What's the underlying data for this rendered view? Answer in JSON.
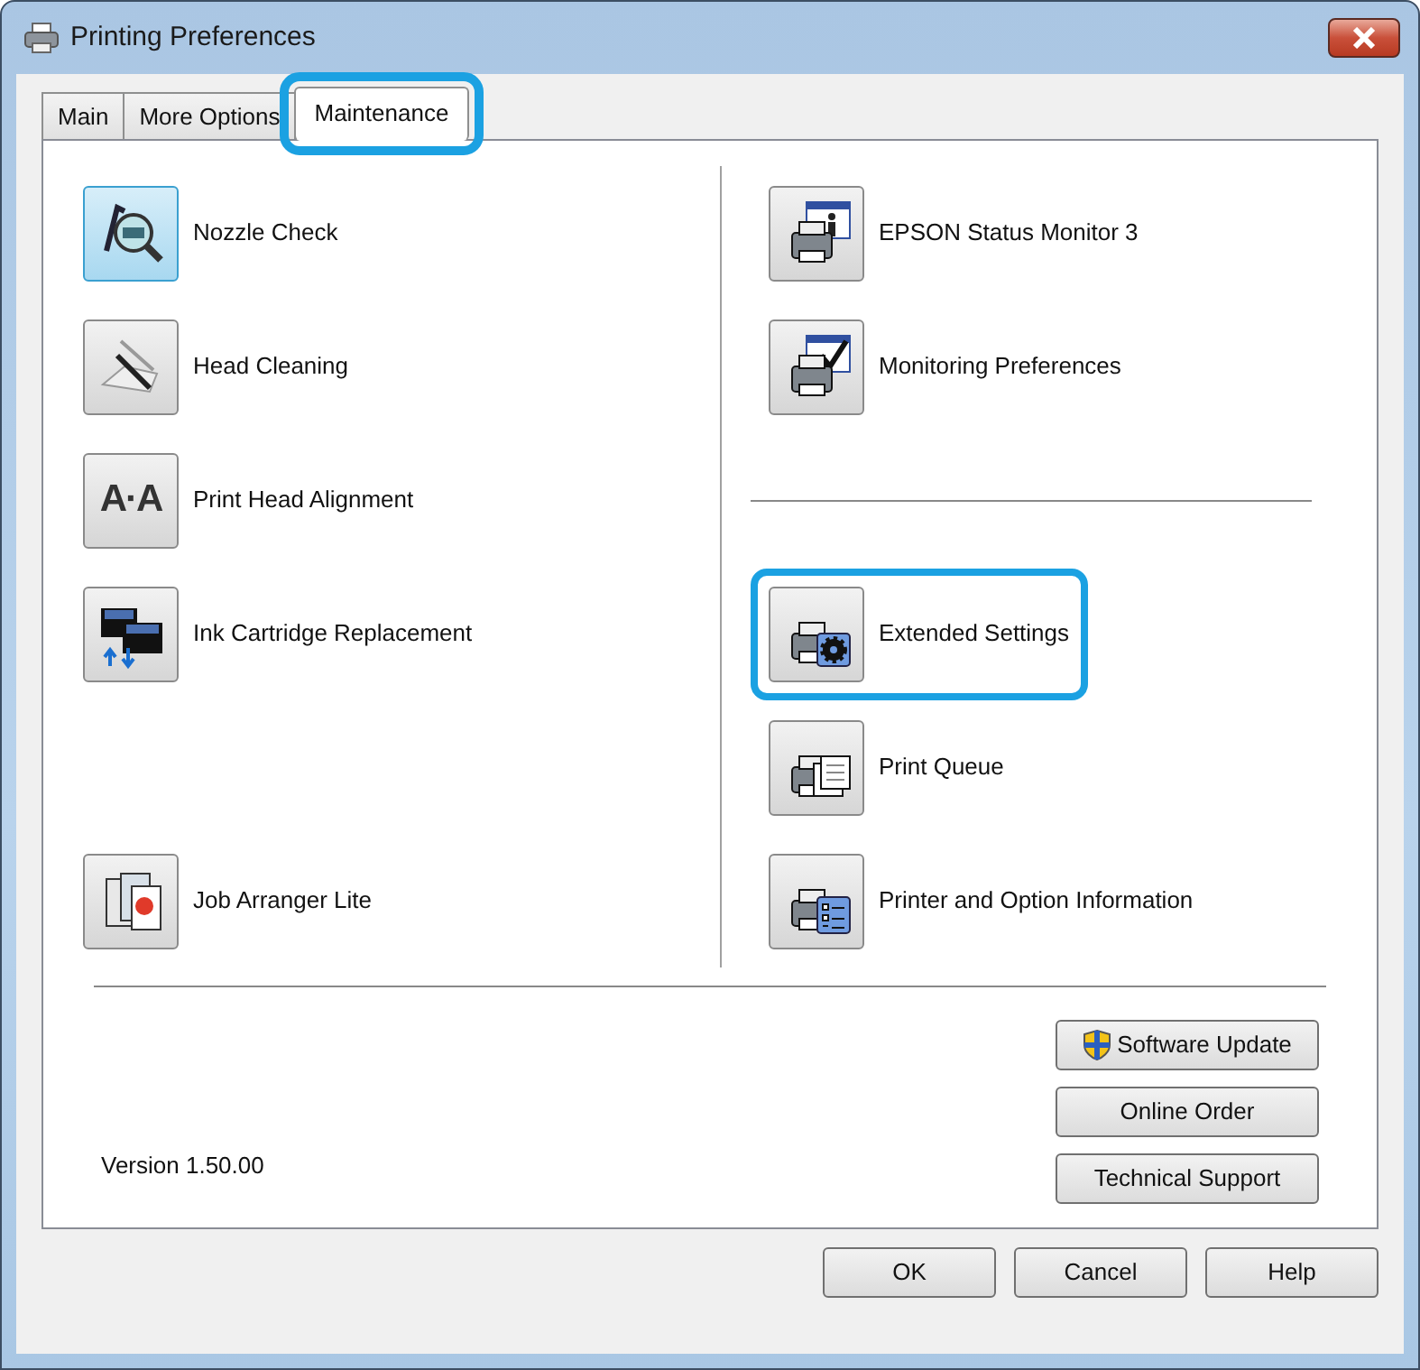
{
  "window": {
    "title": "Printing Preferences"
  },
  "tabs": [
    {
      "label": "Main",
      "selected": false,
      "highlighted": false
    },
    {
      "label": "More Options",
      "selected": false,
      "highlighted": false
    },
    {
      "label": "Maintenance",
      "selected": true,
      "highlighted": true
    }
  ],
  "left_tools": [
    {
      "kind": "nozzle",
      "label": "Nozzle Check",
      "selected": true,
      "highlighted": false
    },
    {
      "kind": "cleaning",
      "label": "Head Cleaning",
      "selected": false,
      "highlighted": false
    },
    {
      "kind": "alignment",
      "glyph": "A·A",
      "label": "Print Head Alignment",
      "selected": false,
      "highlighted": false
    },
    {
      "kind": "cartridge",
      "label": "Ink Cartridge Replacement",
      "selected": false,
      "highlighted": false
    }
  ],
  "left_bottom_tools": [
    {
      "kind": "arranger",
      "label": "Job Arranger Lite",
      "selected": false,
      "highlighted": false
    }
  ],
  "monitor_tools": [
    {
      "kind": "status",
      "label": "EPSON Status Monitor 3",
      "selected": false,
      "highlighted": false
    },
    {
      "kind": "monitoring",
      "label": "Monitoring Preferences",
      "selected": false,
      "highlighted": false
    }
  ],
  "printer_tools": [
    {
      "kind": "extended",
      "label": "Extended Settings",
      "selected": false,
      "highlighted": true
    },
    {
      "kind": "queue",
      "label": "Print Queue",
      "selected": false,
      "highlighted": false
    },
    {
      "kind": "info",
      "label": "Printer and Option Information",
      "selected": false,
      "highlighted": false
    }
  ],
  "version": "Version 1.50.00",
  "side_buttons": [
    {
      "label": "Software Update",
      "shield": true
    },
    {
      "label": "Online Order",
      "shield": false
    },
    {
      "label": "Technical Support",
      "shield": false
    }
  ],
  "dialog_buttons": [
    "OK",
    "Cancel",
    "Help"
  ]
}
